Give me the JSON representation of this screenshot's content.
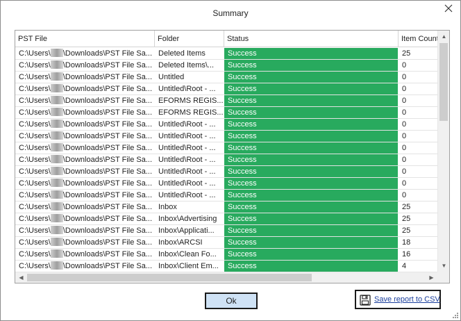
{
  "window": {
    "title": "Summary"
  },
  "table": {
    "headers": [
      "PST File",
      "Folder",
      "Status",
      "Item Count"
    ],
    "rows": [
      {
        "pst_pre": "C:\\Users\\",
        "pst_post": "\\Downloads\\PST File Sa...",
        "folder": "Deleted Items",
        "status": "Success",
        "count": "25"
      },
      {
        "pst_pre": "C:\\Users\\",
        "pst_post": "\\Downloads\\PST File Sa...",
        "folder": "Deleted Items\\...",
        "status": "Success",
        "count": "0"
      },
      {
        "pst_pre": "C:\\Users\\",
        "pst_post": "\\Downloads\\PST File Sa...",
        "folder": "Untitled",
        "status": "Success",
        "count": "0"
      },
      {
        "pst_pre": "C:\\Users\\",
        "pst_post": "\\Downloads\\PST File Sa...",
        "folder": "Untitled\\Root - ...",
        "status": "Success",
        "count": "0"
      },
      {
        "pst_pre": "C:\\Users\\",
        "pst_post": "\\Downloads\\PST File Sa...",
        "folder": "EFORMS REGIS...",
        "status": "Success",
        "count": "0"
      },
      {
        "pst_pre": "C:\\Users\\",
        "pst_post": "\\Downloads\\PST File Sa...",
        "folder": "EFORMS REGIS...",
        "status": "Success",
        "count": "0"
      },
      {
        "pst_pre": "C:\\Users\\",
        "pst_post": "\\Downloads\\PST File Sa...",
        "folder": "Untitled\\Root - ...",
        "status": "Success",
        "count": "0"
      },
      {
        "pst_pre": "C:\\Users\\",
        "pst_post": "\\Downloads\\PST File Sa...",
        "folder": "Untitled\\Root - ...",
        "status": "Success",
        "count": "0"
      },
      {
        "pst_pre": "C:\\Users\\",
        "pst_post": "\\Downloads\\PST File Sa...",
        "folder": "Untitled\\Root - ...",
        "status": "Success",
        "count": "0"
      },
      {
        "pst_pre": "C:\\Users\\",
        "pst_post": "\\Downloads\\PST File Sa...",
        "folder": "Untitled\\Root - ...",
        "status": "Success",
        "count": "0"
      },
      {
        "pst_pre": "C:\\Users\\",
        "pst_post": "\\Downloads\\PST File Sa...",
        "folder": "Untitled\\Root - ...",
        "status": "Success",
        "count": "0"
      },
      {
        "pst_pre": "C:\\Users\\",
        "pst_post": "\\Downloads\\PST File Sa...",
        "folder": "Untitled\\Root - ...",
        "status": "Success",
        "count": "0"
      },
      {
        "pst_pre": "C:\\Users\\",
        "pst_post": "\\Downloads\\PST File Sa...",
        "folder": "Untitled\\Root - ...",
        "status": "Success",
        "count": "0"
      },
      {
        "pst_pre": "C:\\Users\\",
        "pst_post": "\\Downloads\\PST File Sa...",
        "folder": "Inbox",
        "status": "Success",
        "count": "25"
      },
      {
        "pst_pre": "C:\\Users\\",
        "pst_post": "\\Downloads\\PST File Sa...",
        "folder": "Inbox\\Advertising",
        "status": "Success",
        "count": "25"
      },
      {
        "pst_pre": "C:\\Users\\",
        "pst_post": "\\Downloads\\PST File Sa...",
        "folder": "Inbox\\Applicati...",
        "status": "Success",
        "count": "25"
      },
      {
        "pst_pre": "C:\\Users\\",
        "pst_post": "\\Downloads\\PST File Sa...",
        "folder": "Inbox\\ARCSI",
        "status": "Success",
        "count": "18"
      },
      {
        "pst_pre": "C:\\Users\\",
        "pst_post": "\\Downloads\\PST File Sa...",
        "folder": "Inbox\\Clean Fo...",
        "status": "Success",
        "count": "16"
      },
      {
        "pst_pre": "C:\\Users\\",
        "pst_post": "\\Downloads\\PST File Sa...",
        "folder": "Inbox\\Client Em...",
        "status": "Success",
        "count": "4"
      }
    ]
  },
  "colors": {
    "success": "#28aa5e",
    "link": "#1a3e9c",
    "ok_button": "#cfe2f5"
  },
  "icons": {
    "close": "close-icon",
    "save": "floppy-disk-icon",
    "grip": "resize-grip-icon"
  },
  "buttons": {
    "ok": "Ok",
    "save_report": "Save report to CSV"
  }
}
